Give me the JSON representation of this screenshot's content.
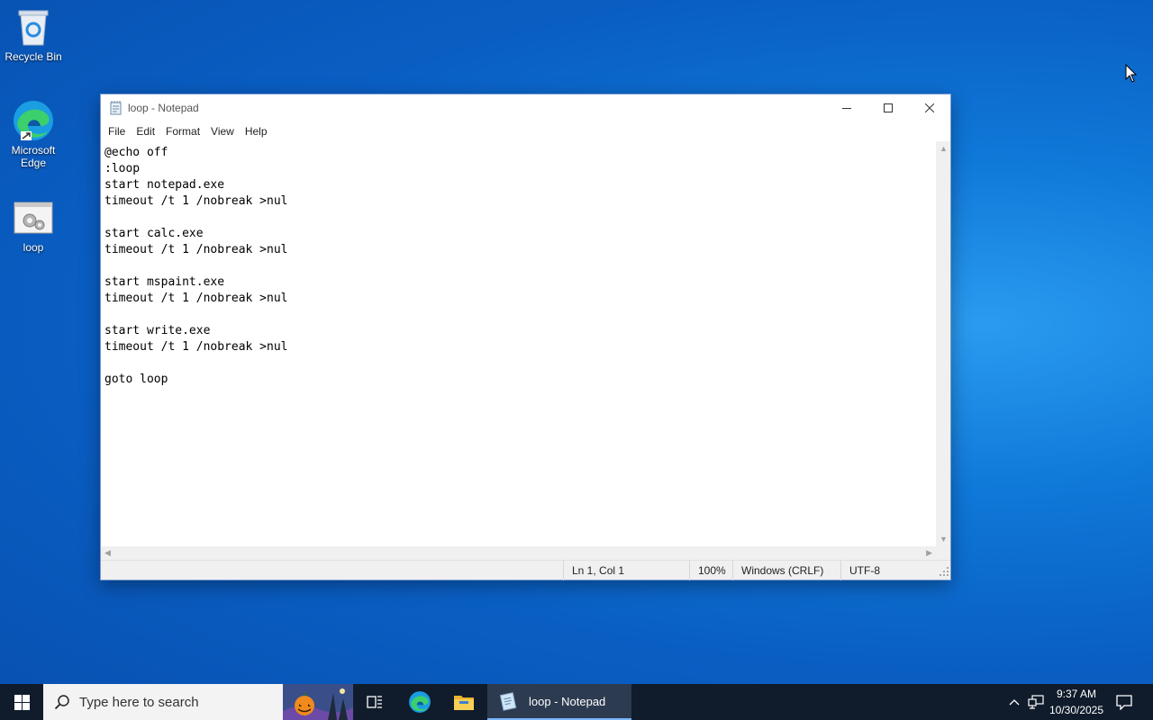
{
  "desktop": {
    "icons": [
      {
        "label": "Recycle Bin",
        "icon": "recycle-bin-icon"
      },
      {
        "label": "Microsoft Edge",
        "icon": "edge-icon"
      },
      {
        "label": "loop",
        "icon": "batch-file-icon"
      }
    ]
  },
  "notepad": {
    "title": "loop - Notepad",
    "menu": [
      "File",
      "Edit",
      "Format",
      "View",
      "Help"
    ],
    "content": "@echo off\n:loop\nstart notepad.exe\ntimeout /t 1 /nobreak >nul\n\nstart calc.exe\ntimeout /t 1 /nobreak >nul\n\nstart mspaint.exe\ntimeout /t 1 /nobreak >nul\n\nstart write.exe\ntimeout /t 1 /nobreak >nul\n\ngoto loop",
    "status": {
      "position": "Ln 1, Col 1",
      "zoom": "100%",
      "line_ending": "Windows (CRLF)",
      "encoding": "UTF-8"
    }
  },
  "taskbar": {
    "search_placeholder": "Type here to search",
    "active_task": "loop - Notepad",
    "time": "9:37 AM",
    "date": "10/30/2025"
  },
  "colors": {
    "desktop_bg": "#0a6ad0",
    "taskbar_bg": "#101c2c",
    "accent": "#78b4ff"
  }
}
